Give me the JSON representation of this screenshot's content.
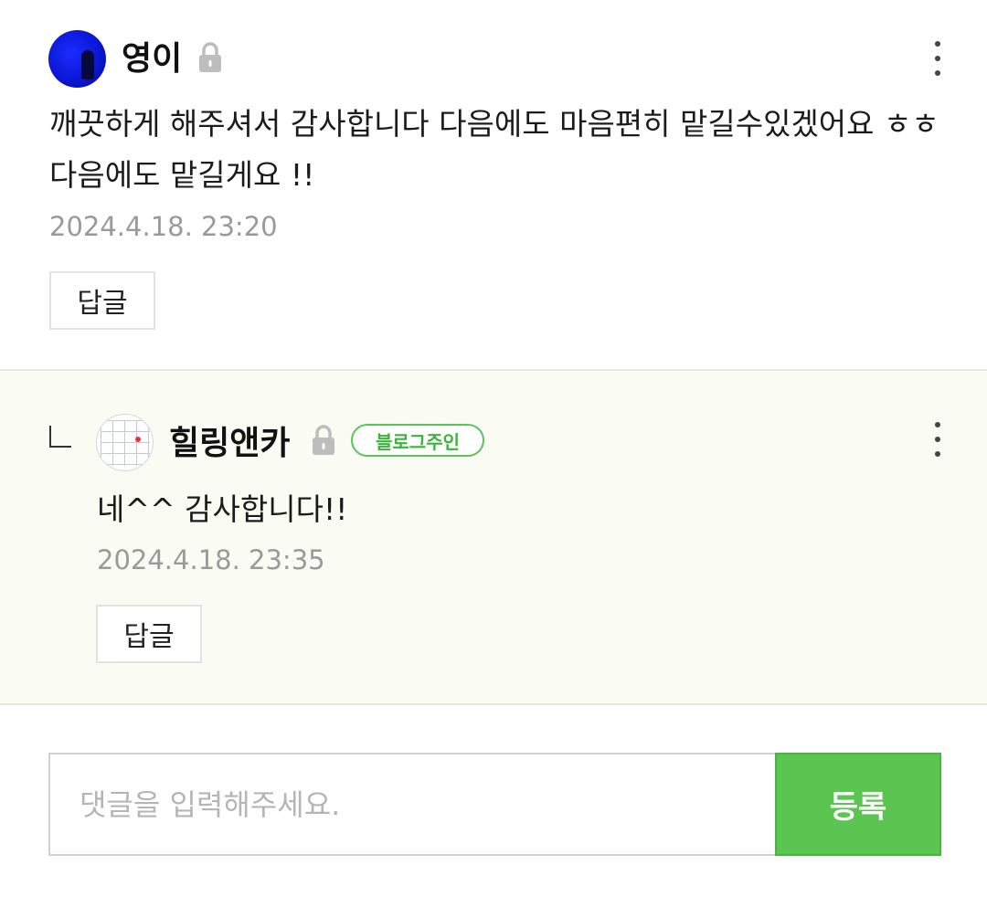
{
  "comments": [
    {
      "author": "영이",
      "text": "깨끗하게 해주셔서 감사합니다 다음에도 마음편히 맡길수있겠어요 ㅎㅎ 다음에도 맡길게요 !!",
      "date": "2024.4.18. 23:20",
      "reply_label": "답글",
      "secret_icon": "lock-icon",
      "menu_icon": "more-vertical-icon"
    },
    {
      "author": "힐링앤카",
      "badge": "블로그주인",
      "text": "네^^ 감사합니다!!",
      "date": "2024.4.18. 23:35",
      "reply_label": "답글",
      "secret_icon": "lock-icon",
      "menu_icon": "more-vertical-icon",
      "is_reply": true
    }
  ],
  "comment_input": {
    "placeholder": "댓글을 입력해주세요.",
    "value": "",
    "submit_label": "등록"
  },
  "colors": {
    "accent_green": "#5bc551",
    "reply_background": "#fafcf3",
    "date_gray": "#9a9a9a"
  }
}
